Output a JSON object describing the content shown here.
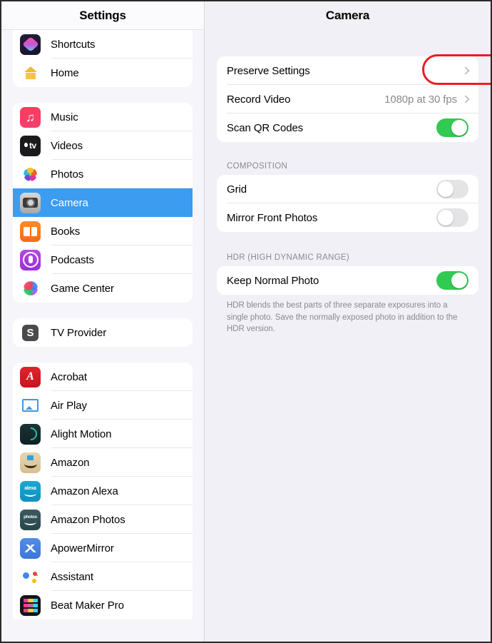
{
  "sidebar": {
    "title": "Settings",
    "groups": [
      {
        "name": "apps-group-1",
        "items": [
          {
            "label": "Shortcuts",
            "icon": "shortcuts-icon",
            "selected": false
          },
          {
            "label": "Home",
            "icon": "home-icon",
            "selected": false
          }
        ]
      },
      {
        "name": "apps-group-2",
        "items": [
          {
            "label": "Music",
            "icon": "music-icon",
            "selected": false
          },
          {
            "label": "Videos",
            "icon": "apple-tv-icon",
            "selected": false
          },
          {
            "label": "Photos",
            "icon": "photos-icon",
            "selected": false
          },
          {
            "label": "Camera",
            "icon": "camera-icon",
            "selected": true
          },
          {
            "label": "Books",
            "icon": "books-icon",
            "selected": false
          },
          {
            "label": "Podcasts",
            "icon": "podcasts-icon",
            "selected": false
          },
          {
            "label": "Game Center",
            "icon": "game-center-icon",
            "selected": false
          }
        ]
      },
      {
        "name": "apps-group-3",
        "items": [
          {
            "label": "TV Provider",
            "icon": "tv-provider-icon",
            "selected": false
          }
        ]
      },
      {
        "name": "apps-group-4",
        "items": [
          {
            "label": "Acrobat",
            "icon": "acrobat-icon",
            "selected": false
          },
          {
            "label": "Air Play",
            "icon": "airplay-icon",
            "selected": false
          },
          {
            "label": "Alight Motion",
            "icon": "alight-motion-icon",
            "selected": false
          },
          {
            "label": "Amazon",
            "icon": "amazon-icon",
            "selected": false
          },
          {
            "label": "Amazon Alexa",
            "icon": "amazon-alexa-icon",
            "selected": false
          },
          {
            "label": "Amazon Photos",
            "icon": "amazon-photos-icon",
            "selected": false
          },
          {
            "label": "ApowerMirror",
            "icon": "apowermirror-icon",
            "selected": false
          },
          {
            "label": "Assistant",
            "icon": "google-assistant-icon",
            "selected": false
          },
          {
            "label": "Beat Maker Pro",
            "icon": "beat-maker-pro-icon",
            "selected": false
          }
        ]
      }
    ]
  },
  "detail": {
    "title": "Camera",
    "group1": {
      "preserve_settings_label": "Preserve Settings",
      "record_video_label": "Record Video",
      "record_video_value": "1080p at 30 fps",
      "scan_qr_label": "Scan QR Codes",
      "scan_qr_on": true
    },
    "composition": {
      "section_label": "COMPOSITION",
      "grid_label": "Grid",
      "grid_on": false,
      "mirror_label": "Mirror Front Photos",
      "mirror_on": false
    },
    "hdr": {
      "section_label": "HDR (HIGH DYNAMIC RANGE)",
      "keep_normal_label": "Keep Normal Photo",
      "keep_normal_on": true,
      "footnote": "HDR blends the best parts of three separate exposures into a single photo. Save the normally exposed photo in addition to the HDR version."
    }
  },
  "annotation": {
    "highlight_color": "#ED1C24",
    "highlight_target": "Preserve Settings"
  },
  "colors": {
    "selection_blue": "#3C9CF0",
    "toggle_on_green": "#31CA52",
    "toggle_off_gray": "#E4E4E6",
    "background": "#F1F0F6",
    "card_white": "#FFFFFF",
    "secondary_text": "#8A8A8E"
  }
}
